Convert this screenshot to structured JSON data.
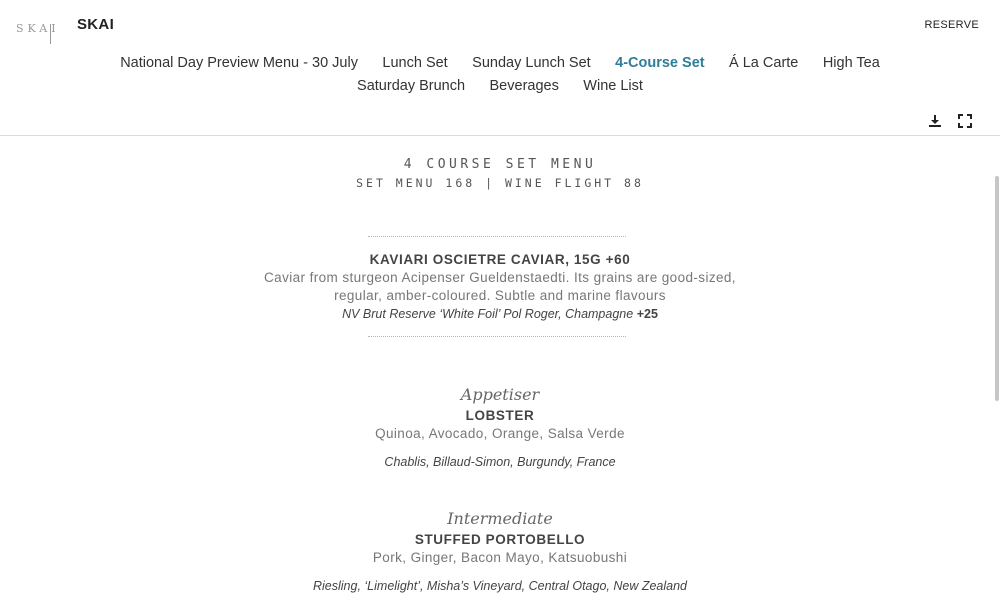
{
  "header": {
    "logo_text": "SKAI",
    "site_title": "SKAI",
    "reserve_label": "RESERVE"
  },
  "nav": {
    "row1": [
      "National Day Preview Menu - 30 July",
      "Lunch Set",
      "Sunday Lunch Set",
      "4-Course Set",
      "Á La Carte",
      "High Tea"
    ],
    "row2": [
      "Saturday Brunch",
      "Beverages",
      "Wine List"
    ],
    "active": "4-Course Set",
    "active_color": "#2e7d9a"
  },
  "tools": {
    "icons": [
      "download-icon",
      "fullscreen-icon"
    ]
  },
  "menu": {
    "title": "4 COURSE SET MENU",
    "subtitle": "SET MENU 168 | WINE FLIGHT 88",
    "featured": {
      "name": "KAVIARI OSCIETRE CAVIAR, 15G +60",
      "desc_line1": "Caviar from sturgeon Acipenser Gueldenstaedti. Its grains are good-sized,",
      "desc_line2": "regular, amber-coloured. Subtle and marine flavours",
      "wine": "NV Brut Reserve ‘White Foil’ Pol Roger, Champagne",
      "wine_price": "+25"
    },
    "courses": [
      {
        "course": "Appetiser",
        "name": "LOBSTER",
        "desc": "Quinoa, Avocado, Orange, Salsa Verde",
        "wine": "Chablis, Billaud-Simon, Burgundy, France"
      },
      {
        "course": "Intermediate",
        "name": "STUFFED PORTOBELLO",
        "desc": "Pork, Ginger, Bacon Mayo, Katsuobushi",
        "wine": "Riesling, ‘Limelight’, Misha’s Vineyard, Central Otago, New Zealand"
      }
    ]
  }
}
